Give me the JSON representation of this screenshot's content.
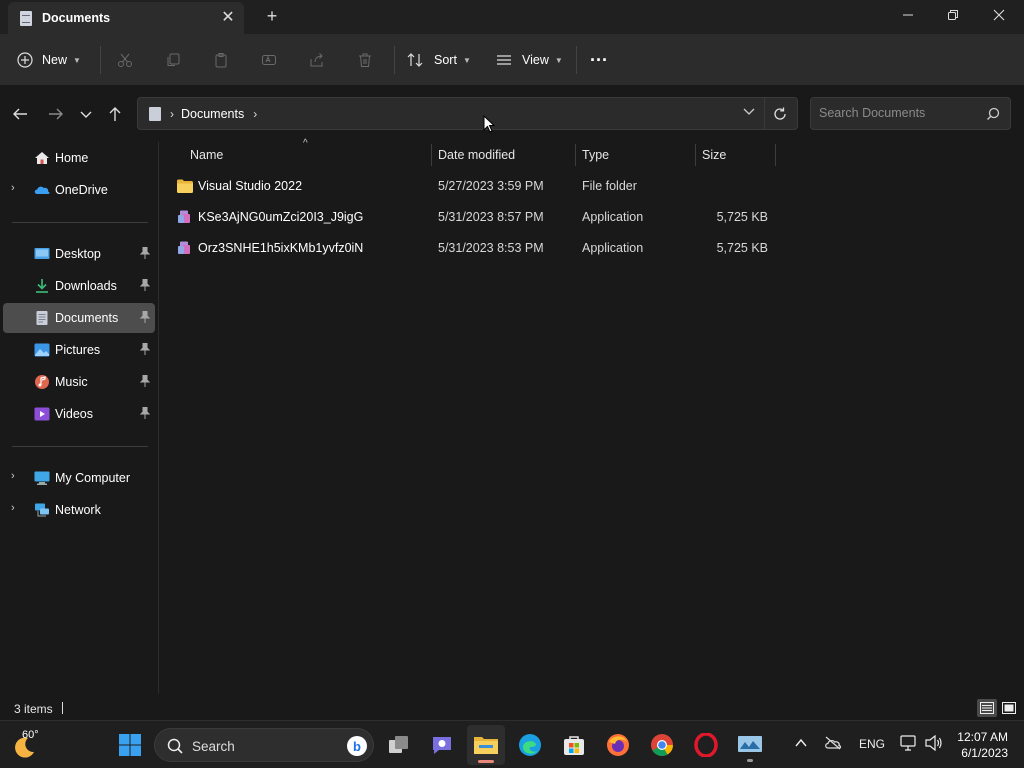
{
  "window": {
    "tab_title": "Documents",
    "new_tab": "+"
  },
  "toolbar": {
    "new_label": "New",
    "sort_label": "Sort",
    "view_label": "View",
    "more_label": "···"
  },
  "address": {
    "crumbs": [
      "Documents"
    ],
    "search_placeholder": "Search Documents"
  },
  "sidebar": {
    "items": [
      {
        "label": "Home",
        "icon": "home-icon",
        "expandable": false
      },
      {
        "label": "OneDrive",
        "icon": "onedrive-icon",
        "expandable": true
      },
      {
        "label": "Desktop",
        "icon": "desktop-icon",
        "pinned": true
      },
      {
        "label": "Downloads",
        "icon": "download-icon",
        "pinned": true
      },
      {
        "label": "Documents",
        "icon": "documents-icon",
        "pinned": true,
        "selected": true
      },
      {
        "label": "Pictures",
        "icon": "pictures-icon",
        "pinned": true
      },
      {
        "label": "Music",
        "icon": "music-icon",
        "pinned": true
      },
      {
        "label": "Videos",
        "icon": "videos-icon",
        "pinned": true
      },
      {
        "label": "My Computer",
        "icon": "computer-icon",
        "expandable": true
      },
      {
        "label": "Network",
        "icon": "network-icon",
        "expandable": true
      }
    ]
  },
  "columns": {
    "name": "Name",
    "date": "Date modified",
    "type": "Type",
    "size": "Size"
  },
  "files": [
    {
      "name": "Visual Studio 2022",
      "date": "5/27/2023 3:59 PM",
      "type": "File folder",
      "size": "",
      "icon": "folder-icon"
    },
    {
      "name": "KSe3AjNG0umZci20I3_J9igG",
      "date": "5/31/2023 8:57 PM",
      "type": "Application",
      "size": "5,725 KB",
      "icon": "application-icon"
    },
    {
      "name": "Orz3SNHE1h5ixKMb1yvfz0iN",
      "date": "5/31/2023 8:53 PM",
      "type": "Application",
      "size": "5,725 KB",
      "icon": "application-icon"
    }
  ],
  "status": {
    "item_count": "3 items"
  },
  "taskbar": {
    "temperature": "60°",
    "search_label": "Search",
    "language": "ENG",
    "time": "12:07 AM",
    "date": "6/1/2023"
  },
  "colors": {
    "background": "#191919",
    "toolbar": "#2c2c2c",
    "selected": "#4d4d4d",
    "folder": "#f2c14e",
    "accent": "#0078d4"
  }
}
